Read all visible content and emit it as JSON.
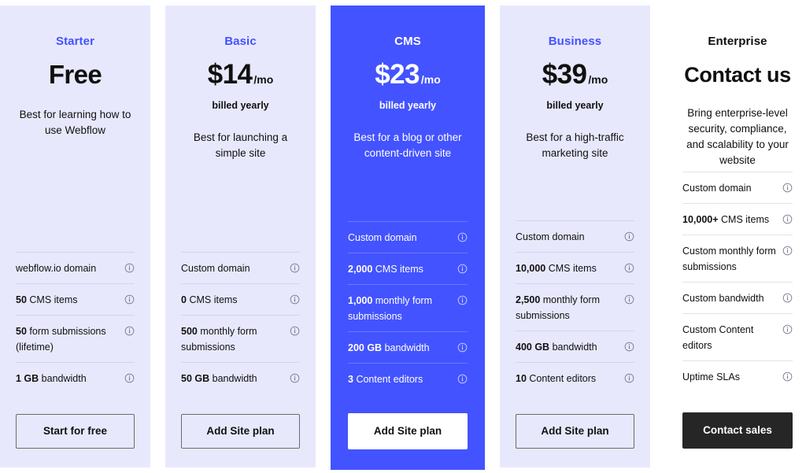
{
  "colors": {
    "accent": "#4353ff",
    "card_bg": "#e8e8fd",
    "featured_bg": "#4353ff",
    "dark_button": "#262626",
    "divider": "#d3d3f3",
    "text": "#101010"
  },
  "icons": {
    "info": "info-icon"
  },
  "plans": [
    {
      "id": "starter",
      "name": "Starter",
      "price": "Free",
      "period": "",
      "billing": "",
      "description": "Best for learning how to use Webflow",
      "features": [
        {
          "value": "",
          "label": "webflow.io domain"
        },
        {
          "value": "50",
          "label": "CMS items"
        },
        {
          "value": "50",
          "label": "form submissions (lifetime)"
        },
        {
          "value": "1 GB",
          "label": "bandwidth"
        }
      ],
      "cta": "Start for free"
    },
    {
      "id": "basic",
      "name": "Basic",
      "price": "$14",
      "period": "/mo",
      "billing": "billed yearly",
      "description": "Best for launching a simple site",
      "features": [
        {
          "value": "",
          "label": "Custom domain"
        },
        {
          "value": "0",
          "label": "CMS items"
        },
        {
          "value": "500",
          "label": "monthly form submissions"
        },
        {
          "value": "50 GB",
          "label": "bandwidth"
        }
      ],
      "cta": "Add Site plan"
    },
    {
      "id": "cms",
      "name": "CMS",
      "price": "$23",
      "period": "/mo",
      "billing": "billed yearly",
      "description": "Best for a blog or other content-driven site",
      "features": [
        {
          "value": "",
          "label": "Custom domain"
        },
        {
          "value": "2,000",
          "label": "CMS items"
        },
        {
          "value": "1,000",
          "label": "monthly form submissions"
        },
        {
          "value": "200 GB",
          "label": "bandwidth"
        },
        {
          "value": "3",
          "label": "Content editors"
        }
      ],
      "cta": "Add Site plan"
    },
    {
      "id": "business",
      "name": "Business",
      "price": "$39",
      "period": "/mo",
      "billing": "billed yearly",
      "description": "Best for a high-traffic marketing site",
      "features": [
        {
          "value": "",
          "label": "Custom domain"
        },
        {
          "value": "10,000",
          "label": "CMS items"
        },
        {
          "value": "2,500",
          "label": "monthly form submissions"
        },
        {
          "value": "400 GB",
          "label": "bandwidth"
        },
        {
          "value": "10",
          "label": "Content editors"
        }
      ],
      "cta": "Add Site plan"
    },
    {
      "id": "enterprise",
      "name": "Enterprise",
      "price": "Contact us",
      "period": "",
      "billing": "",
      "description": "Bring enterprise-level security, compliance, and scalability to your website",
      "features": [
        {
          "value": "",
          "label": "Custom domain"
        },
        {
          "value": "10,000+",
          "label": "CMS items"
        },
        {
          "value": "",
          "label": "Custom monthly form submissions"
        },
        {
          "value": "",
          "label": "Custom bandwidth"
        },
        {
          "value": "",
          "label": "Custom Content editors"
        },
        {
          "value": "",
          "label": "Uptime SLAs"
        }
      ],
      "cta": "Contact sales"
    }
  ]
}
